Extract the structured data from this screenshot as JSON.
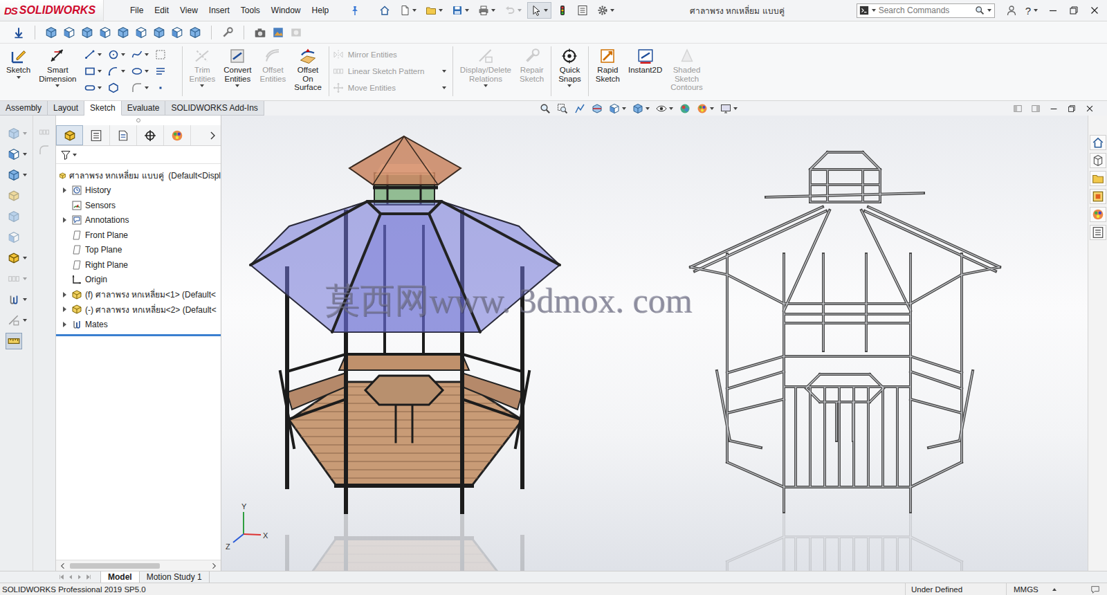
{
  "app": {
    "logo_mark": "DS",
    "logo": "SOLIDWORKS"
  },
  "menu": [
    "File",
    "Edit",
    "View",
    "Insert",
    "Tools",
    "Window",
    "Help"
  ],
  "quick_access": [
    {
      "disabled": false,
      "selected": false
    },
    {
      "disabled": false,
      "selected": false
    },
    {
      "disabled": false,
      "selected": false
    },
    {
      "disabled": false,
      "selected": false
    },
    {
      "disabled": false,
      "selected": false
    },
    {
      "disabled": true,
      "selected": false
    },
    {
      "disabled": false,
      "selected": true
    },
    {
      "disabled": false,
      "selected": false
    },
    {
      "disabled": false,
      "selected": false
    },
    {
      "disabled": false,
      "selected": false
    }
  ],
  "window": {
    "title": "ศาลาพรง หกเหลี่ยม แบบคู่"
  },
  "search": {
    "placeholder": "Search Commands"
  },
  "help": "?",
  "command_groups": [
    {
      "kind": "large",
      "items": [
        {
          "label": "Sketch",
          "disabled": false
        },
        {
          "label": "Smart\nDimension",
          "disabled": false
        }
      ]
    },
    {
      "kind": "palette",
      "items": []
    },
    {
      "kind": "large",
      "items": [
        {
          "label": "Trim\nEntities",
          "disabled": true
        },
        {
          "label": "Convert\nEntities",
          "disabled": false
        },
        {
          "label": "Offset\nEntities",
          "disabled": true
        },
        {
          "label": "Offset\nOn\nSurface",
          "disabled": false
        }
      ]
    },
    {
      "kind": "stack",
      "items": [
        {
          "label": "Mirror Entities",
          "disabled": true
        },
        {
          "label": "Linear Sketch Pattern",
          "disabled": true
        },
        {
          "label": "Move Entities",
          "disabled": true
        }
      ]
    },
    {
      "kind": "large",
      "items": [
        {
          "label": "Display/Delete\nRelations",
          "disabled": true
        },
        {
          "label": "Repair\nSketch",
          "disabled": true
        }
      ]
    },
    {
      "kind": "large",
      "items": [
        {
          "label": "Quick\nSnaps",
          "disabled": false
        }
      ]
    },
    {
      "kind": "large",
      "items": [
        {
          "label": "Rapid\nSketch",
          "disabled": false
        },
        {
          "label": "Instant2D",
          "disabled": false
        },
        {
          "label": "Shaded\nSketch\nContours",
          "disabled": true
        }
      ]
    }
  ],
  "tabs": [
    {
      "label": "Assembly",
      "selected": false
    },
    {
      "label": "Layout",
      "selected": false
    },
    {
      "label": "Sketch",
      "selected": true
    },
    {
      "label": "Evaluate",
      "selected": false
    },
    {
      "label": "SOLIDWORKS Add-Ins",
      "selected": false
    }
  ],
  "left_toolbar": [
    {
      "disabled": true,
      "selected": false
    },
    {
      "disabled": false,
      "selected": false
    },
    {
      "disabled": false,
      "selected": false
    },
    {
      "disabled": true,
      "selected": false
    },
    {
      "disabled": true,
      "selected": false
    },
    {
      "disabled": true,
      "selected": false
    },
    {
      "disabled": false,
      "selected": false
    },
    {
      "disabled": true,
      "selected": false
    },
    {
      "disabled": false,
      "selected": false
    },
    {
      "disabled": false,
      "selected": false
    },
    {
      "disabled": false,
      "selected": true
    }
  ],
  "panel_tabs": [
    {
      "selected": true
    },
    {
      "selected": false
    },
    {
      "selected": false
    },
    {
      "selected": false
    },
    {
      "selected": false
    }
  ],
  "tree": {
    "root": "ศาลาพรง หกเหลี่ยม แบบคู่  (Default<Displ",
    "items": [
      {
        "label": "History",
        "expandable": true
      },
      {
        "label": "Sensors",
        "expandable": false
      },
      {
        "label": "Annotations",
        "expandable": true
      },
      {
        "label": "Front Plane",
        "expandable": false
      },
      {
        "label": "Top Plane",
        "expandable": false
      },
      {
        "label": "Right Plane",
        "expandable": false
      },
      {
        "label": "Origin",
        "expandable": false
      },
      {
        "label": "(f) ศาลาพรง หกเหลี่ยม<1> (Default<",
        "expandable": true
      },
      {
        "label": "(-) ศาลาพรง หกเหลี่ยม<2> (Default<",
        "expandable": true
      },
      {
        "label": "Mates",
        "expandable": true
      }
    ]
  },
  "viewport": {
    "watermark": "莫西网www. 3dmox. com",
    "triad": {
      "y": "Y",
      "x": "X",
      "z": "Z"
    }
  },
  "bottom_tabs": [
    {
      "label": "Model",
      "selected": true
    },
    {
      "label": "Motion Study 1",
      "selected": false
    }
  ],
  "status_bar": {
    "product": "SOLIDWORKS Professional 2019 SP5.0",
    "state": "Under Defined",
    "units": "MMGS"
  }
}
